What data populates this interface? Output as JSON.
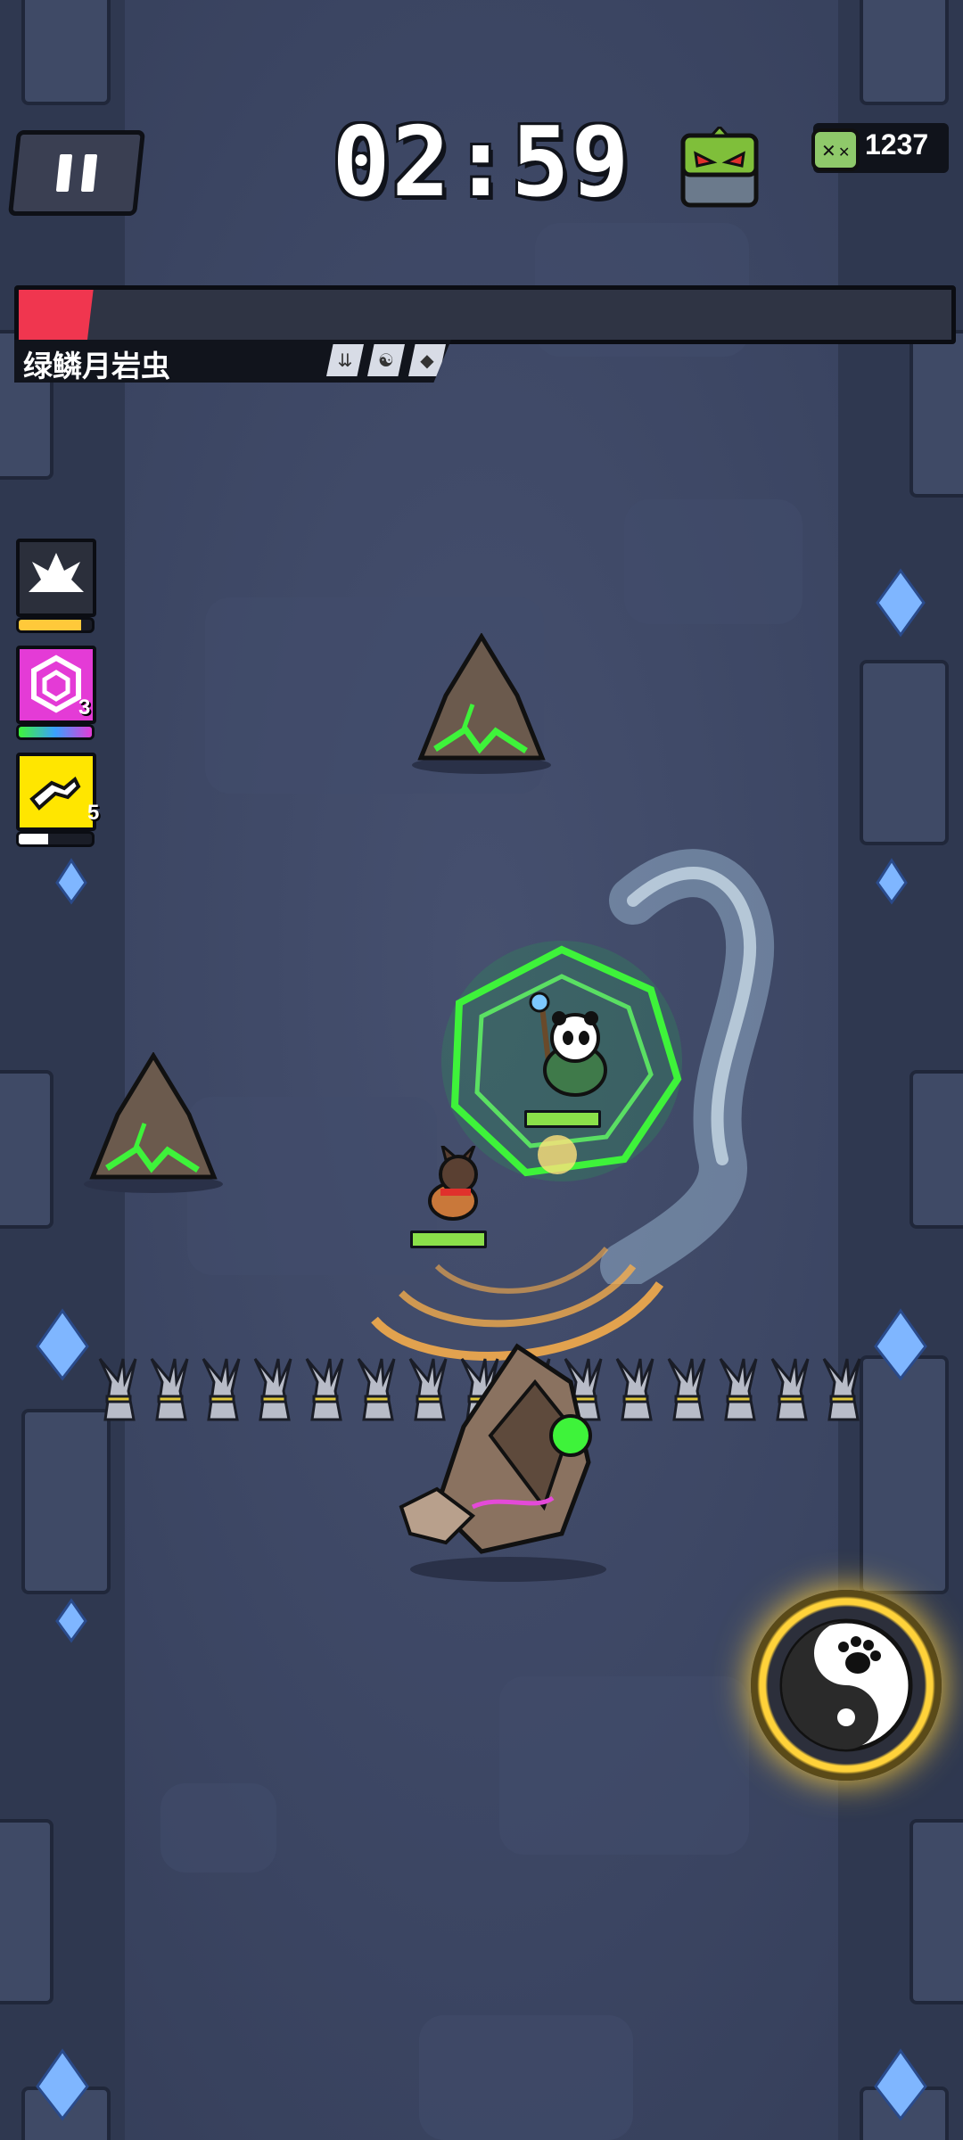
{
  "hud": {
    "timer": "02:59",
    "kill_count": "1237",
    "boss_name": "绿鳞月岩虫",
    "boss_health": 0.08
  },
  "skills": [
    {
      "icon": "explosion-icon",
      "color": "#2b2f3b",
      "count": "",
      "progress": 0.85
    },
    {
      "icon": "hexagon-shield-icon",
      "color": "#e43bd6",
      "count": "3",
      "progress": 1.0
    },
    {
      "icon": "sprint-icon",
      "color": "#ffe600",
      "count": "5",
      "progress": 0.4
    }
  ],
  "boss_traits": [
    "down-arrows-icon",
    "yin-yang-icon",
    "crystal-icon"
  ],
  "player": {
    "health": 1.0
  },
  "pet": {
    "health": 1.0
  },
  "colors": {
    "boss_bar": "#f0364f",
    "health": "#8be04a",
    "accent_gold": "#ffcf3a",
    "poison_green": "#3ef33a"
  },
  "ultimate": {
    "icon": "paw-yin-yang-icon"
  }
}
